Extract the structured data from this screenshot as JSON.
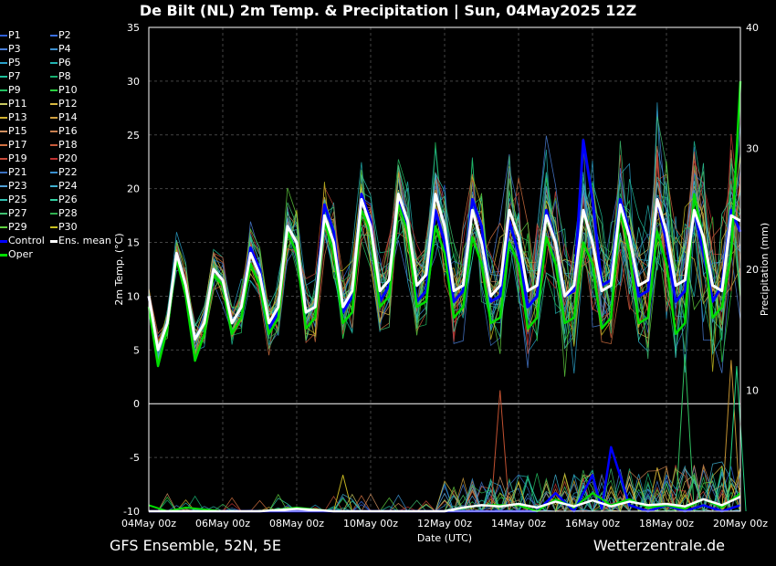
{
  "title": "De Bilt  (NL)  2m Temp. & Precipitation | Sun, 04May2025 12Z",
  "footer": {
    "left": "GFS Ensemble, 52N, 5E",
    "right": "Wetterzentrale.de"
  },
  "chart_data": {
    "type": "line",
    "title": "De Bilt  (NL)  2m Temp. & Precipitation | Sun, 04May2025 12Z",
    "xlabel": "Date (UTC)",
    "ylabel": "2m Temp. (°C)",
    "y2label": "Precipitation (mm)",
    "ylim": [
      -10,
      35
    ],
    "y2lim": [
      0,
      40
    ],
    "yticks": [
      35,
      30,
      25,
      20,
      15,
      10,
      5,
      0,
      -5,
      -10
    ],
    "y2ticks": [
      40,
      30,
      20,
      10
    ],
    "xticks": [
      "04May 00z",
      "06May 00z",
      "08May 00z",
      "10May 00z",
      "12May 00z",
      "14May 00z",
      "16May 00z",
      "18May 00z",
      "20May 00z"
    ],
    "x_range_days": [
      0,
      16
    ],
    "grid": true,
    "legend_placement": "left",
    "legend": [
      {
        "name": "P1",
        "color": "#2e5fd6"
      },
      {
        "name": "P2",
        "color": "#3a6ee0"
      },
      {
        "name": "P3",
        "color": "#4a7fd8"
      },
      {
        "name": "P4",
        "color": "#3c8fcf"
      },
      {
        "name": "P5",
        "color": "#2aa0c8"
      },
      {
        "name": "P6",
        "color": "#22b2b0"
      },
      {
        "name": "P7",
        "color": "#1fc09a"
      },
      {
        "name": "P8",
        "color": "#18b070"
      },
      {
        "name": "P9",
        "color": "#22c060"
      },
      {
        "name": "P10",
        "color": "#2ad040"
      },
      {
        "name": "P11",
        "color": "#c8c860"
      },
      {
        "name": "P12",
        "color": "#d8b840"
      },
      {
        "name": "P13",
        "color": "#d0b030"
      },
      {
        "name": "P14",
        "color": "#d0a040"
      },
      {
        "name": "P15",
        "color": "#d09060"
      },
      {
        "name": "P16",
        "color": "#c88050"
      },
      {
        "name": "P17",
        "color": "#d07040"
      },
      {
        "name": "P18",
        "color": "#c85a3a"
      },
      {
        "name": "P19",
        "color": "#c84a3a"
      },
      {
        "name": "P20",
        "color": "#c03030"
      },
      {
        "name": "P21",
        "color": "#3a70c0"
      },
      {
        "name": "P22",
        "color": "#3a90d0"
      },
      {
        "name": "P23",
        "color": "#50a0d8"
      },
      {
        "name": "P24",
        "color": "#40b0d0"
      },
      {
        "name": "P25",
        "color": "#30c0b0"
      },
      {
        "name": "P26",
        "color": "#30d0a0"
      },
      {
        "name": "P27",
        "color": "#40c070"
      },
      {
        "name": "P28",
        "color": "#30b050"
      },
      {
        "name": "P29",
        "color": "#60d040"
      },
      {
        "name": "P30",
        "color": "#c8c020"
      },
      {
        "name": "Control",
        "color": "#0000ff"
      },
      {
        "name": "Ens. mean",
        "color": "#ffffff"
      },
      {
        "name": "Oper",
        "color": "#00dd00"
      }
    ],
    "series_temperature": [
      {
        "name": "Ens. mean",
        "x": [
          0,
          0.25,
          0.5,
          0.75,
          1,
          1.25,
          1.5,
          1.75,
          2,
          2.25,
          2.5,
          2.75,
          3,
          3.25,
          3.5,
          3.75,
          4,
          4.25,
          4.5,
          4.75,
          5,
          5.25,
          5.5,
          5.75,
          6,
          6.25,
          6.5,
          6.75,
          7,
          7.25,
          7.5,
          7.75,
          8,
          8.25,
          8.5,
          8.75,
          9,
          9.25,
          9.5,
          9.75,
          10,
          10.25,
          10.5,
          10.75,
          11,
          11.25,
          11.5,
          11.75,
          12,
          12.25,
          12.5,
          12.75,
          13,
          13.25,
          13.5,
          13.75,
          14,
          14.25,
          14.5,
          14.75,
          15,
          15.25,
          15.5,
          15.75,
          16
        ],
        "y": [
          10,
          5,
          7.5,
          14,
          11,
          6,
          7.5,
          12.5,
          11.5,
          7.5,
          9,
          14,
          12,
          7.5,
          9,
          16.5,
          15,
          8.5,
          9,
          17.5,
          15,
          9,
          10.5,
          19,
          16.5,
          10.5,
          11.5,
          19.5,
          17,
          11,
          12,
          19.5,
          16.5,
          10.5,
          11,
          18,
          15,
          10,
          11,
          18,
          15.5,
          10.5,
          11,
          17.5,
          15,
          10,
          11,
          18,
          15,
          10.5,
          11,
          18.5,
          15.5,
          11,
          11.5,
          19,
          16,
          11,
          11.5,
          18,
          15.5,
          11,
          10.5,
          17.5,
          17
        ]
      },
      {
        "name": "Control",
        "x": [
          0,
          0.25,
          0.5,
          0.75,
          1,
          1.25,
          1.5,
          1.75,
          2,
          2.25,
          2.5,
          2.75,
          3,
          3.25,
          3.5,
          3.75,
          4,
          4.25,
          4.5,
          4.75,
          5,
          5.25,
          5.5,
          5.75,
          6,
          6.25,
          6.5,
          6.75,
          7,
          7.25,
          7.5,
          7.75,
          8,
          8.25,
          8.5,
          8.75,
          9,
          9.25,
          9.5,
          9.75,
          10,
          10.25,
          10.5,
          10.75,
          11,
          11.25,
          11.5,
          11.75,
          12,
          12.25,
          12.5,
          12.75,
          13,
          13.25,
          13.5,
          13.75,
          14,
          14.25,
          14.5,
          14.75,
          15,
          15.25,
          15.5,
          15.75,
          16
        ],
        "y": [
          10,
          5,
          7.5,
          14,
          11,
          6,
          7.5,
          12.5,
          11.5,
          7.5,
          9,
          14.5,
          12.5,
          7,
          8.5,
          16.5,
          15,
          8.5,
          9,
          18.5,
          16,
          8.5,
          10,
          19.5,
          17,
          9.5,
          11,
          19,
          16,
          9.5,
          10.5,
          18,
          15,
          9.5,
          10.5,
          19,
          16.5,
          9.5,
          10,
          17,
          14,
          9,
          10,
          18,
          15,
          10,
          10.5,
          24.5,
          19,
          11,
          11.5,
          19,
          16,
          10,
          10.5,
          19,
          15,
          9.5,
          10.5,
          18,
          14,
          9.5,
          11,
          18,
          16
        ]
      },
      {
        "name": "Oper",
        "x": [
          0,
          0.25,
          0.5,
          0.75,
          1,
          1.25,
          1.5,
          1.75,
          2,
          2.25,
          2.5,
          2.75,
          3,
          3.25,
          3.5,
          3.75,
          4,
          4.25,
          4.5,
          4.75,
          5,
          5.25,
          5.5,
          5.75,
          6,
          6.25,
          6.5,
          6.75,
          7,
          7.25,
          7.5,
          7.75,
          8,
          8.25,
          8.5,
          8.75,
          9,
          9.25,
          9.5,
          9.75,
          10,
          10.25,
          10.5,
          10.75,
          11,
          11.25,
          11.5,
          11.75,
          12,
          12.25,
          12.5,
          12.75,
          13,
          13.25,
          13.5,
          13.75,
          14,
          14.25,
          14.5,
          14.75,
          15,
          15.25,
          15.5,
          15.75,
          16
        ],
        "y": [
          9,
          3.5,
          7,
          13.5,
          10,
          4,
          6.5,
          12,
          11,
          6.5,
          8,
          13,
          11,
          6.5,
          8,
          16,
          14,
          7,
          8,
          17,
          14,
          7.5,
          8.5,
          18,
          16,
          9,
          10,
          18.5,
          16,
          9,
          9.5,
          16.5,
          14,
          8,
          9,
          15.5,
          13,
          7.5,
          8,
          15,
          13,
          7,
          8,
          15.5,
          13,
          7.5,
          8,
          15,
          13,
          7,
          8,
          18,
          14,
          7.5,
          8,
          16,
          13,
          6.5,
          7.5,
          19.5,
          15,
          8,
          9,
          14,
          30
        ]
      }
    ],
    "series_precipitation_mm": [
      {
        "name": "Ens. mean",
        "x": [
          0,
          1,
          2,
          3,
          4,
          5,
          6,
          7,
          8,
          8.5,
          9,
          9.5,
          10,
          10.5,
          11,
          11.5,
          12,
          12.5,
          13,
          13.5,
          14,
          14.5,
          15,
          15.5,
          16
        ],
        "y": [
          0,
          0,
          0,
          0,
          0.2,
          0,
          0,
          0,
          0,
          0.3,
          0.5,
          0.4,
          0.6,
          0.3,
          0.8,
          0.4,
          0.9,
          0.4,
          0.8,
          0.5,
          0.6,
          0.4,
          1,
          0.5,
          1.2
        ]
      },
      {
        "name": "Control",
        "x": [
          0,
          1,
          2,
          3,
          4,
          5,
          6,
          7,
          8,
          9,
          10,
          10.5,
          11,
          11.5,
          12,
          12.25,
          12.5,
          13,
          13.5,
          14,
          14.5,
          15,
          15.5,
          16
        ],
        "y": [
          0,
          0,
          0,
          0,
          0,
          0,
          0,
          0,
          0,
          0,
          0,
          0,
          1.5,
          0,
          3,
          0.2,
          5.3,
          0.5,
          0,
          0.5,
          0,
          0.5,
          0,
          0.5
        ]
      },
      {
        "name": "Oper",
        "x": [
          0,
          0.5,
          1,
          2,
          3,
          4,
          5,
          6,
          7,
          8,
          9,
          10,
          10.5,
          11,
          11.5,
          12,
          12.5,
          13,
          13.5,
          14,
          14.5,
          15,
          15.5,
          16
        ],
        "y": [
          0.5,
          0,
          0.3,
          0,
          0,
          0.3,
          0,
          0,
          0,
          0,
          0.5,
          0.5,
          0,
          1,
          0.3,
          1.5,
          0.5,
          1,
          0.3,
          0.5,
          0.2,
          1,
          0.3,
          1.5
        ]
      }
    ],
    "precip_spikes_mm": [
      {
        "x": 9.5,
        "y": 10
      },
      {
        "x": 5.25,
        "y": 3
      },
      {
        "x": 14.5,
        "y": 13
      },
      {
        "x": 15.75,
        "y": 12.5
      },
      {
        "x": 15.9,
        "y": 12
      }
    ]
  }
}
